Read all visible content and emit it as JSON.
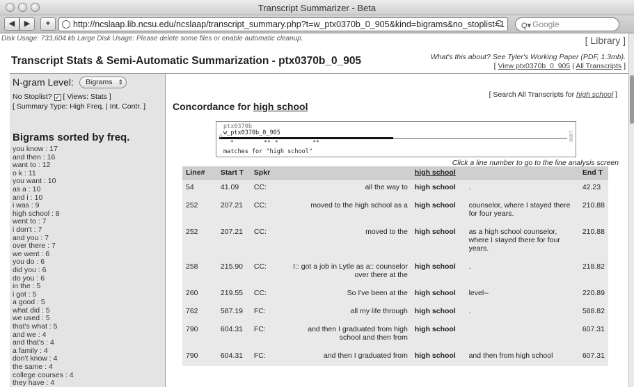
{
  "window": {
    "title": "Transcript Summarizer - Beta",
    "url": "http://ncslaap.lib.ncsu.edu/ncslaap/transcript_summary.php?t=w_ptx0370b_0_905&kind=bigrams&no_stoplist=1",
    "search_placeholder": "Google",
    "back_label": "◀",
    "forward_label": "▶",
    "add_label": "+",
    "reload_label": "C"
  },
  "page": {
    "disk_usage": "Disk Usage: 733,604 kb Large Disk Usage: Please delete some files or enable automatic cleanup.",
    "library_link": "[ Library ]",
    "header_title": "Transcript Stats & Semi-Automatic Summarization - ptx0370b_0_905",
    "about_prefix": "What's this about? See Tyler's Working Paper (PDF, 1.3mb).",
    "view_link": "View ptx0370b_0_905",
    "all_transcripts_link": "All Transcripts"
  },
  "sidebar": {
    "ngram_label": "N-gram Level:",
    "ngram_value": "Bigrams",
    "no_stoplist_label": "No Stoplist?",
    "no_stoplist_checked": "✓",
    "views_text": "[ Views: Stats ]",
    "summary_type_text": "[ Summary Type: High Freq. | Int. Contr. ]",
    "bigrams_heading": "Bigrams sorted by freq.",
    "bigrams": [
      "you know : 17",
      "and then : 16",
      "want to : 12",
      "o k : 11",
      "you want : 10",
      "as a : 10",
      "and i : 10",
      "i was : 9",
      "high school : 8",
      "went to : 7",
      "i don't : 7",
      "and you : 7",
      "over there : 7",
      "we went : 6",
      "you do : 6",
      "did you : 6",
      "do you : 6",
      "in the : 5",
      "i got : 5",
      "a good : 5",
      "what did : 5",
      "we used : 5",
      "that's what : 5",
      "and we : 4",
      "and that's : 4",
      "a family : 4",
      "don't know : 4",
      "the same : 4",
      "college courses : 4",
      "they have : 4"
    ]
  },
  "main": {
    "search_all_prefix": "[ Search All Transcripts for",
    "search_all_term": "high school",
    "search_all_suffix": "]",
    "concordance_prefix": "Concordance for",
    "concordance_term": "high school",
    "graphic_file_label": "ptx0370b",
    "graphic_name": "w_ptx0370b_0_905",
    "graphic_caption": "matches for \"high school\"",
    "graphic_left_tick": "0",
    "graphic_right_tick": "1800",
    "click_hint": "Click a line number to go to the line analysis screen",
    "columns": [
      "Line#",
      "Start T",
      "Spkr",
      "",
      "high school",
      "",
      "End T"
    ],
    "rows": [
      {
        "line": "54",
        "start": "41.09",
        "spkr": "CC:",
        "pre": "all the way to",
        "kw": "high school",
        "post": ".",
        "end": "42.23"
      },
      {
        "line": "252",
        "start": "207.21",
        "spkr": "CC:",
        "pre": "moved to the high school as a",
        "kw": "high school",
        "post": "counselor, where I stayed there for four years.",
        "end": "210.88"
      },
      {
        "line": "252",
        "start": "207.21",
        "spkr": "CC:",
        "pre": "moved to the",
        "kw": "high school",
        "post": "as a high school counselor, where I stayed there for four years.",
        "end": "210.88"
      },
      {
        "line": "258",
        "start": "215.90",
        "spkr": "CC:",
        "pre": "I:: got a job in Lytle as a:: counselor over there at the",
        "kw": "high school",
        "post": ".",
        "end": "218.82"
      },
      {
        "line": "260",
        "start": "219.55",
        "spkr": "CC:",
        "pre": "So I've been at the",
        "kw": "high school",
        "post": "level--",
        "end": "220.89"
      },
      {
        "line": "762",
        "start": "587.19",
        "spkr": "FC:",
        "pre": "all my life through",
        "kw": "high school",
        "post": ".",
        "end": "588.82"
      },
      {
        "line": "790",
        "start": "604.31",
        "spkr": "FC:",
        "pre": "and then I graduated from high school and then from",
        "kw": "high school",
        "post": "",
        "end": "607.31"
      },
      {
        "line": "790",
        "start": "604.31",
        "spkr": "FC:",
        "pre": "and then I graduated from",
        "kw": "high school",
        "post": "and then from high school",
        "end": "607.31"
      }
    ]
  }
}
